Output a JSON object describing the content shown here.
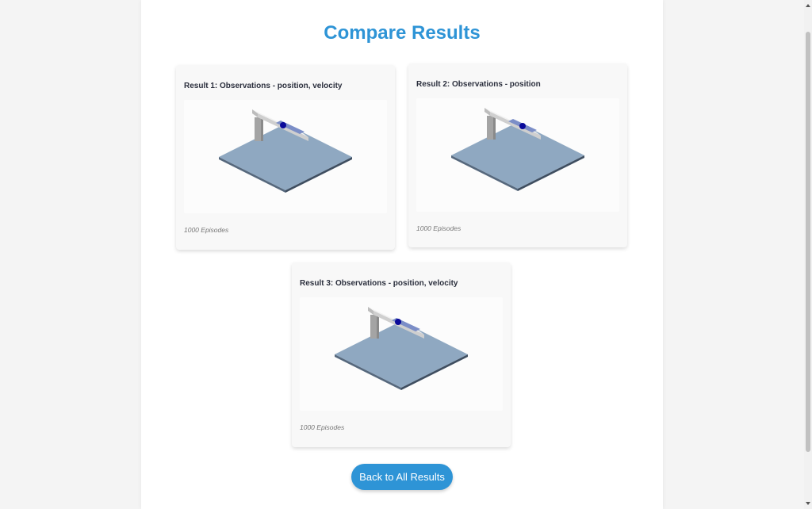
{
  "page": {
    "title": "Compare Results"
  },
  "results": [
    {
      "title": "Result 1: Observations - position, velocity",
      "episodes": "1000 Episodes"
    },
    {
      "title": "Result 2: Observations - position",
      "episodes": "1000 Episodes"
    },
    {
      "title": "Result 3: Observations - position, velocity",
      "episodes": "1000 Episodes"
    }
  ],
  "actions": {
    "back_label": "Back to All Results"
  },
  "colors": {
    "accent": "#2e94d6",
    "floor": "#8fa8c1",
    "ball": "#0a0a9a"
  }
}
